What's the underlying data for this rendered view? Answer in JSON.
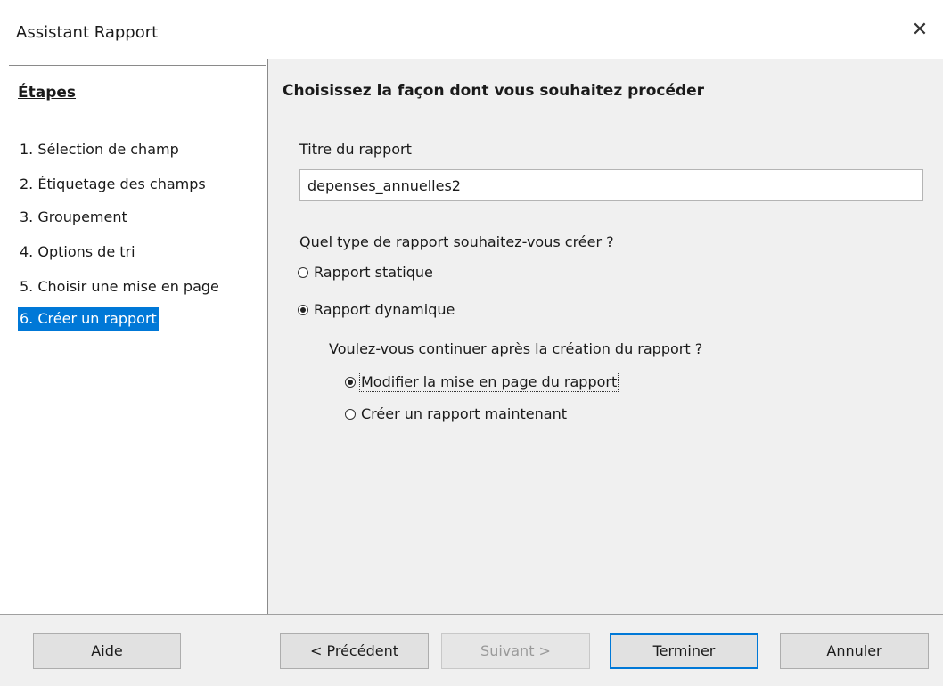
{
  "window": {
    "title": "Assistant Rapport",
    "close_glyph": "✕"
  },
  "steps": {
    "heading": "Étapes",
    "items": [
      {
        "label": "1. Sélection de champ",
        "active": false
      },
      {
        "label": "2. Étiquetage des champs",
        "active": false
      },
      {
        "label": "3. Groupement",
        "active": false
      },
      {
        "label": "4. Options de tri",
        "active": false
      },
      {
        "label": "5. Choisir une mise en page",
        "active": false
      },
      {
        "label": "6. Créer un rapport",
        "active": true
      }
    ]
  },
  "main": {
    "heading": "Choisissez la façon dont vous souhaitez procéder",
    "title_label": "Titre du rapport",
    "title_value": "depenses_annuelles2",
    "type_question": "Quel type de rapport souhaitez-vous créer ?",
    "type_options": [
      {
        "label": "Rapport statique",
        "selected": false
      },
      {
        "label": "Rapport dynamique",
        "selected": true
      }
    ],
    "continue_question": "Voulez-vous continuer après la création du rapport ?",
    "continue_options": [
      {
        "label": "Modifier la mise en page du rapport",
        "selected": true
      },
      {
        "label": "Créer un rapport maintenant",
        "selected": false
      }
    ]
  },
  "footer": {
    "help": "Aide",
    "previous": "< Précédent",
    "next": "Suivant >",
    "finish": "Terminer",
    "cancel": "Annuler"
  },
  "colors": {
    "accent": "#0078d7"
  }
}
